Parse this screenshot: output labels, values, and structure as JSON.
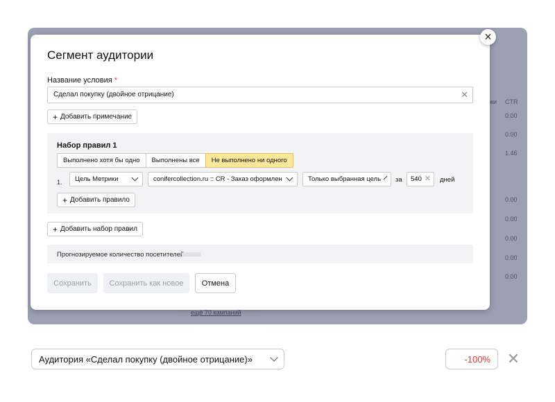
{
  "background": {
    "ctr_header": "CTR",
    "clicks_header": "ики",
    "ctr_values": [
      "0.00",
      "0.00",
      "1.46",
      "0.00",
      "0.00",
      "0.00",
      "0.00",
      "0.00"
    ],
    "more_link": "ещё 70 кампаний"
  },
  "modal": {
    "title": "Сегмент аудитории",
    "name_label": "Название условия",
    "required_mark": "*",
    "name_value": "Сделал покупку (двойное отрицание)",
    "add_note_label": "Добавить примечание",
    "ruleset": {
      "title": "Набор правил 1",
      "modes": [
        "Выполнено хотя бы одно",
        "Выполнены все",
        "Не выполнено ни одного"
      ],
      "active_mode_index": 2,
      "rule": {
        "number": "1.",
        "type": "Цель Метрики",
        "goal": "conifercollection.ru :: CR - Заказ оформлен",
        "scope": "Только выбранная цель",
        "for_label": "за",
        "days_value": "540",
        "days_label": "дней"
      },
      "add_rule_label": "Добавить правило"
    },
    "add_ruleset_label": "Добавить набор правил",
    "forecast_label": "Прогнозируемое количество посетителей:",
    "save_label": "Сохранить",
    "save_as_new_label": "Сохранить как новое",
    "cancel_label": "Отмена"
  },
  "bottom_bar": {
    "audience_label": "Аудитория «Сделал покупку (двойное отрицание)»",
    "percent": "-100%"
  },
  "colors": {
    "accent_active": "#fde89a",
    "danger": "#e5362a",
    "backdrop": "#5f6783"
  }
}
